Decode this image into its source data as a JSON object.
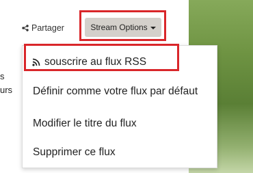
{
  "page": {
    "left_partial_text_1": "s",
    "left_partial_text_2": "urs"
  },
  "toolbar": {
    "share_icon": "share-icon",
    "share_label": "Partager",
    "stream_options_label": "Stream Options",
    "stream_options_caret": "chevron-down-icon"
  },
  "menu": {
    "items": [
      {
        "label": "souscrire au flux RSS",
        "icon": "rss-icon"
      },
      {
        "label": "Définir comme votre flux par défaut"
      },
      {
        "label": "Modifier le titre du flux"
      },
      {
        "label": "Supprimer ce flux"
      }
    ]
  },
  "colors": {
    "highlight": "#d9262a",
    "button_bg": "#d4d0cb",
    "panel_green": "#6f9443"
  }
}
